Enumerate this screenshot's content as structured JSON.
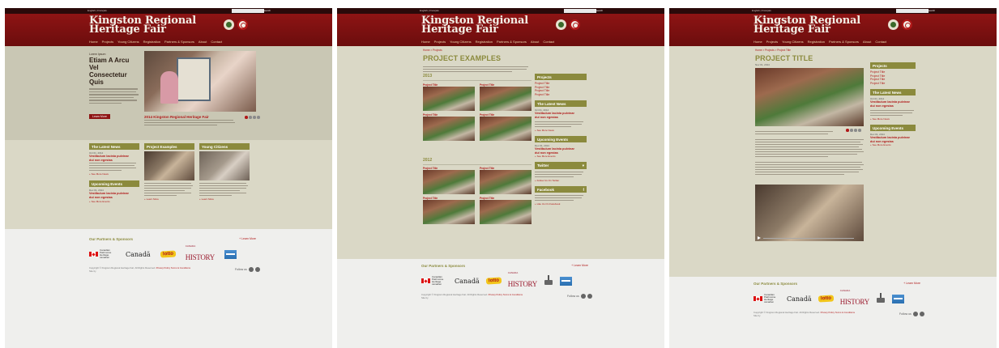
{
  "site": {
    "title_line1": "Kingston Regional",
    "title_line2": "Heritage Fair",
    "topbar_links": "English  |  Français",
    "search_button": "Search",
    "nav": [
      "Home",
      "Projects",
      "Young Citizens",
      "Registration",
      "Partners & Sponsors",
      "About",
      "Contact"
    ]
  },
  "home": {
    "hero_kicker": "Lorem Ipsum",
    "hero_title_1": "Etiam A Arcu Vel",
    "hero_title_2": "Consectetur Quis",
    "learn_more": "Learn More",
    "hero_caption": "2014 Kingston Regional Heritage Fair",
    "read_more": "+ Learn More",
    "latest_news": "The Latest News",
    "project_examples": "Project Examples",
    "young_citizens": "Young Citizens",
    "news_date": "Oct 01, 2014",
    "news_title_1": "Vestibulum lacinia pulvinar",
    "news_title_2": "dui non egestas",
    "read_more_link": "+ Read More",
    "see_more_news": "+ See More News",
    "upcoming_events": "Upcoming Events",
    "event_date": "Dec 01, 2014",
    "event_title_1": "Vestibulum lacinia pulvinar",
    "event_title_2": "dui non egestas",
    "see_more_events": "+ See More Events"
  },
  "projects": {
    "breadcrumb": "Home  >  Projects",
    "title": "PROJECT EXAMPLES",
    "year1": "2013",
    "year2": "2012",
    "thumb_label": "Project Title",
    "sidebar_projects": "Projects",
    "sidebar_items": [
      "Project Title",
      "Project Title",
      "Project Title",
      "Project Title"
    ],
    "twitter": "Twitter",
    "facebook": "Facebook",
    "follow_twitter": "+ Follow Us On Twitter",
    "like_facebook": "+ Like Us On Facebook"
  },
  "detail": {
    "breadcrumb": "Home  >  Projects  >  Project Title",
    "title": "PROJECT TITLE",
    "date": "Nov 01, 2014"
  },
  "footer": {
    "partners": "Our Partners & Sponsors",
    "view_more": "+ Learn More",
    "canada_text": "Canadian Patrimoine Heritage canadien",
    "canada_word": "Canadä",
    "loto": "lotto",
    "history": "HISTORY",
    "history_small": "CANADA",
    "copyright_1": "Copyright © Kingston Regional Heritage Fair. All Rights Reserved.",
    "privacy": "Privacy Policy",
    "terms": "Terms & Conditions",
    "copyright_2": "Site by",
    "follow": "Follow us"
  },
  "colors": {
    "brand_red": "#8e1414",
    "accent_olive": "#8b8a3d",
    "link_red": "#b01818",
    "content_bg": "#dad8c6"
  }
}
